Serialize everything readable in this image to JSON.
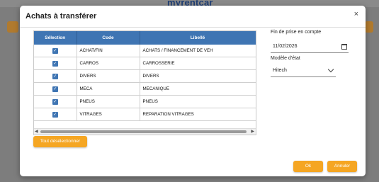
{
  "background": {
    "logo": "myrentcar"
  },
  "dialog": {
    "title": "Achats à transférer",
    "close_label": "×"
  },
  "table": {
    "headers": {
      "selection": "Sélection",
      "code": "Code",
      "libelle": "Libellé"
    },
    "rows": [
      {
        "checked": true,
        "code": "ACHAT/FIN",
        "libelle": "ACHATS / FINANCEMENT DE VEH"
      },
      {
        "checked": true,
        "code": "CARROS",
        "libelle": "CARROSSERIE"
      },
      {
        "checked": true,
        "code": "DIVERS",
        "libelle": "DIVERS"
      },
      {
        "checked": true,
        "code": "MECA",
        "libelle": "MECANIQUE"
      },
      {
        "checked": true,
        "code": "PNEUS",
        "libelle": "PNEUS"
      },
      {
        "checked": true,
        "code": "VITRAGES",
        "libelle": "REPARATION VITRAGES"
      }
    ]
  },
  "buttons": {
    "deselect_all": "Tout désélectionner",
    "ok": "Ok",
    "cancel": "Annuler"
  },
  "fields": {
    "end_date_label": "Fin de prise en compte",
    "end_date_value": "11/02/2026",
    "model_label": "Modèle d'état",
    "model_value": "Hitech"
  },
  "colors": {
    "accent": "#f5a623",
    "header": "#3f75b3"
  }
}
